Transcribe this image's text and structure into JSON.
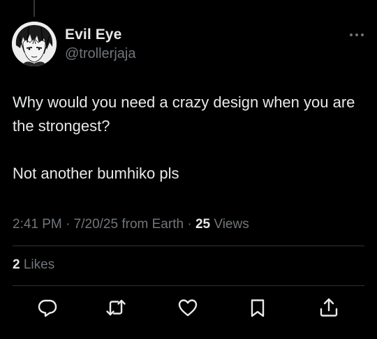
{
  "author": {
    "display_name": "Evil Eye",
    "handle": "@trollerjaja",
    "avatar_icon": "manga-face-avatar"
  },
  "tweet": {
    "paragraphs": [
      "Why would you need a crazy design when you are the strongest?",
      "Not another bumhiko pls"
    ]
  },
  "meta": {
    "time": "2:41 PM",
    "separator": "·",
    "date": "7/20/25",
    "source": "from Earth",
    "views_count": "25",
    "views_label": "Views"
  },
  "engagement": {
    "likes_count": "2",
    "likes_label": "Likes"
  },
  "actions": [
    {
      "name": "reply",
      "icon": "reply-icon"
    },
    {
      "name": "retweet",
      "icon": "retweet-icon"
    },
    {
      "name": "like",
      "icon": "heart-icon"
    },
    {
      "name": "bookmark",
      "icon": "bookmark-icon"
    },
    {
      "name": "share",
      "icon": "share-icon"
    }
  ],
  "colors": {
    "background": "#000000",
    "primary_text": "#e7e9ea",
    "secondary_text": "#71767b",
    "divider": "#2f3336"
  }
}
